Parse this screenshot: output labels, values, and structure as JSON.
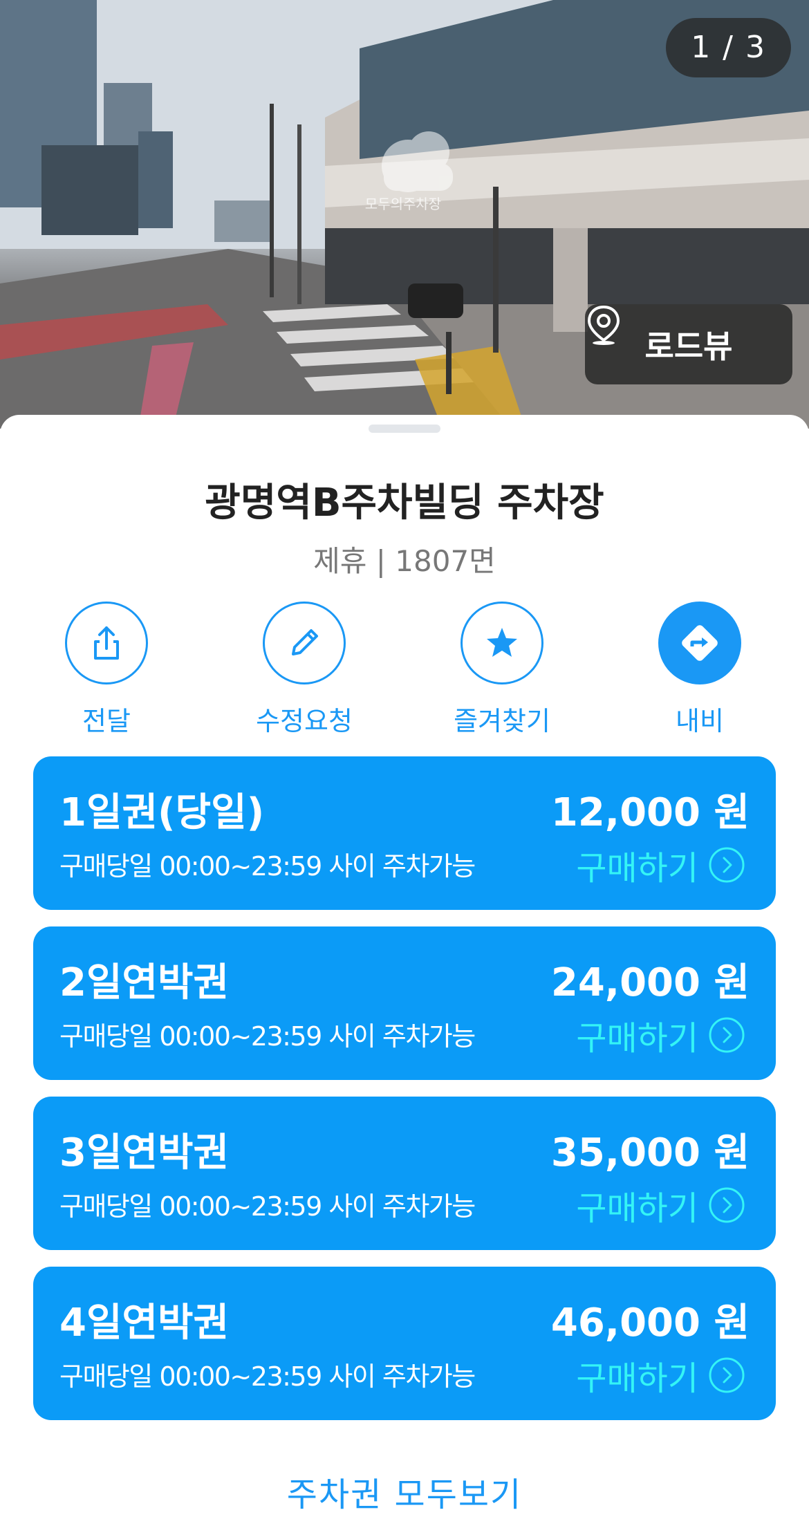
{
  "photo": {
    "counter": "1 / 3",
    "roadview_label": "로드뷰"
  },
  "parking": {
    "title": "광명역B주차빌딩 주차장",
    "subtitle": "제휴 | 1807면"
  },
  "actions": [
    {
      "label": "전달",
      "icon": "share-icon"
    },
    {
      "label": "수정요청",
      "icon": "pencil-icon"
    },
    {
      "label": "즐겨찾기",
      "icon": "star-icon"
    },
    {
      "label": "내비",
      "icon": "navigation-icon"
    }
  ],
  "tickets": [
    {
      "name": "1일권(당일)",
      "desc": "구매당일 00:00~23:59 사이 주차가능",
      "price": "12,000 원",
      "buy": "구매하기"
    },
    {
      "name": "2일연박권",
      "desc": "구매당일 00:00~23:59 사이 주차가능",
      "price": "24,000 원",
      "buy": "구매하기"
    },
    {
      "name": "3일연박권",
      "desc": "구매당일 00:00~23:59 사이 주차가능",
      "price": "35,000 원",
      "buy": "구매하기"
    },
    {
      "name": "4일연박권",
      "desc": "구매당일 00:00~23:59 사이 주차가능",
      "price": "46,000 원",
      "buy": "구매하기"
    }
  ],
  "view_all": "주차권 모두보기",
  "colors": {
    "accent": "#1a98f5",
    "card": "#0b9bf7",
    "buy_text": "#34f4f6"
  }
}
